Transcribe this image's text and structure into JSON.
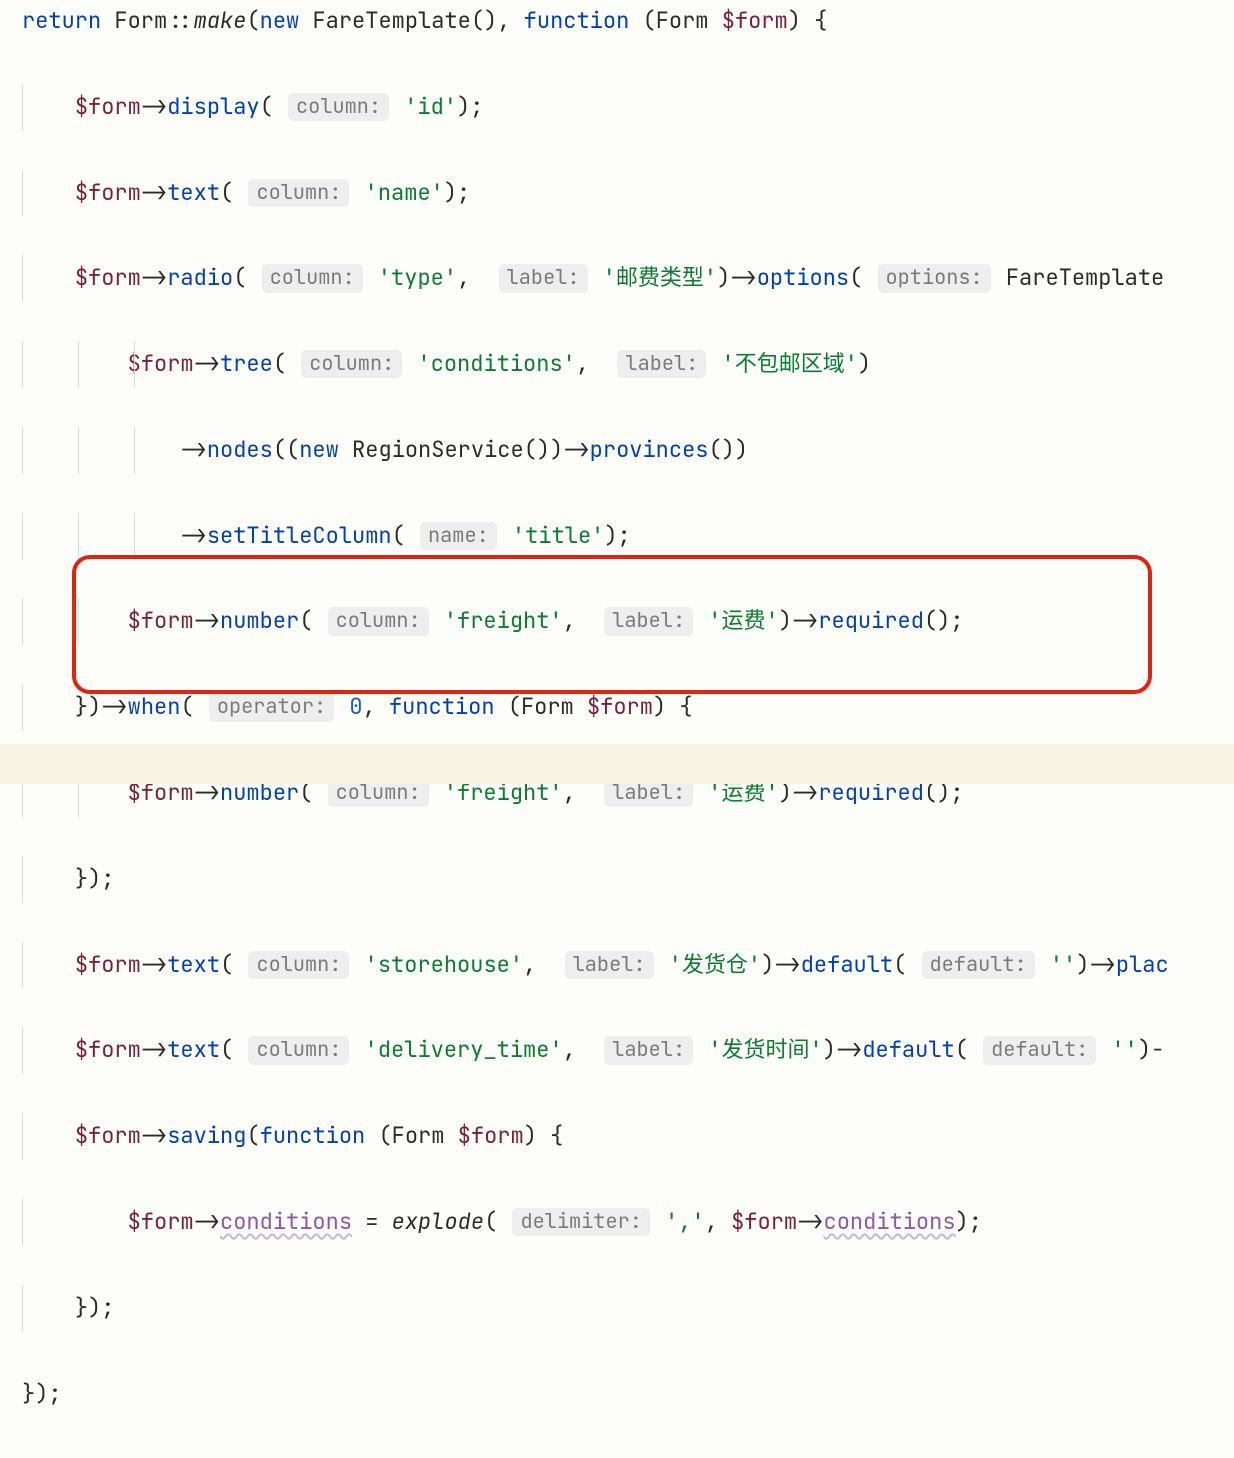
{
  "tokens": {
    "kw_return": "return",
    "kw_function": "function",
    "kw_new": "new",
    "cls_Form": "Form",
    "make": "make",
    "cls_FareTemplate": "FareTemplate",
    "cls_RegionService": "RegionService",
    "var_form": "$form",
    "arrow": "->",
    "dcolon": "::"
  },
  "hints": {
    "column": "column:",
    "label": "label:",
    "options": "options:",
    "operator": "operator:",
    "name": "name:",
    "default": "default:",
    "delimiter": "delimiter:"
  },
  "methods": {
    "display": "display",
    "text": "text",
    "radio": "radio",
    "options": "options",
    "tree": "tree",
    "nodes": "nodes",
    "provinces": "provinces",
    "setTitleColumn": "setTitleColumn",
    "number": "number",
    "required": "required",
    "when": "when",
    "default": "default",
    "plac": "plac",
    "saving": "saving",
    "conditions": "conditions"
  },
  "strings": {
    "id": "'id'",
    "name": "'name'",
    "type": "'type'",
    "postage_type": "'邮费类型'",
    "conditions": "'conditions'",
    "no_ship_region": "'不包邮区域'",
    "title": "'title'",
    "freight": "'freight'",
    "shipping_fee": "'运费'",
    "storehouse": "'storehouse'",
    "ship_warehouse": "'发货仓'",
    "delivery_time": "'delivery_time'",
    "ship_time": "'发货时间'",
    "empty": "''",
    "comma": "','"
  },
  "nums": {
    "zero": "0"
  },
  "fns": {
    "explode": "explode"
  },
  "punct": {
    "open_fn": "(",
    "close_fn": ")",
    "open_brace": "{",
    "close_brace": "}",
    "semi": ";",
    "comma": ",",
    "eq": " = ",
    "close_paren_semi": ");",
    "close_paren_arrow": ")->",
    "close_brace_paren_arrow": "})->",
    "close_brace_paren_semi": "});",
    "empty_parens": "()"
  }
}
